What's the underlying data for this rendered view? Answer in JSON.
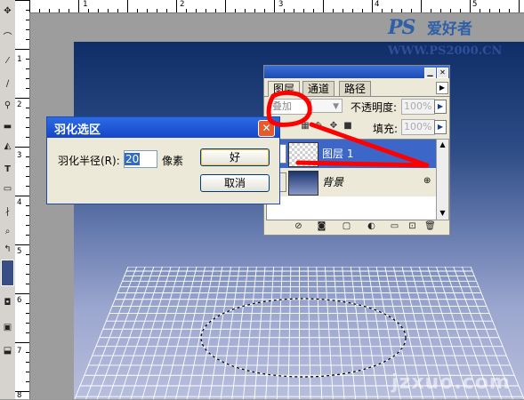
{
  "colors": {
    "annotation": "#ff0000",
    "selected_layer": "#3c66c8",
    "title_bar": "#1d4bb4",
    "canvas_top": "#0f2d66",
    "canvas_bottom": "#b8bedd"
  },
  "rulers": {
    "horizontal": [
      "0",
      "1",
      "2",
      "3",
      "4",
      "5"
    ],
    "vertical": [
      "1",
      "2",
      "3",
      "4",
      "5",
      "6",
      "7",
      "8",
      "9"
    ]
  },
  "watermark": {
    "logo": "PS",
    "logo_name": "爱好者",
    "url": "WWW.PS2000.CN",
    "bottom_text": "jzxuo.com"
  },
  "layers_panel": {
    "tabs": [
      "图层",
      "通道",
      "路径"
    ],
    "blend_mode": "叠加",
    "opacity_label": "不透明度:",
    "opacity_value": "100%",
    "lock_label": "定:",
    "fill_label": "填充:",
    "fill_value": "100%",
    "layers": [
      {
        "name": "图层 1",
        "selected": true,
        "visible": false
      },
      {
        "name": "背景",
        "selected": false,
        "visible": false,
        "locked": true
      }
    ]
  },
  "feather_dialog": {
    "title": "羽化选区",
    "radius_label": "羽化半径(R):",
    "radius_value": "20",
    "unit": "像素",
    "ok_label": "好",
    "cancel_label": "取消"
  }
}
